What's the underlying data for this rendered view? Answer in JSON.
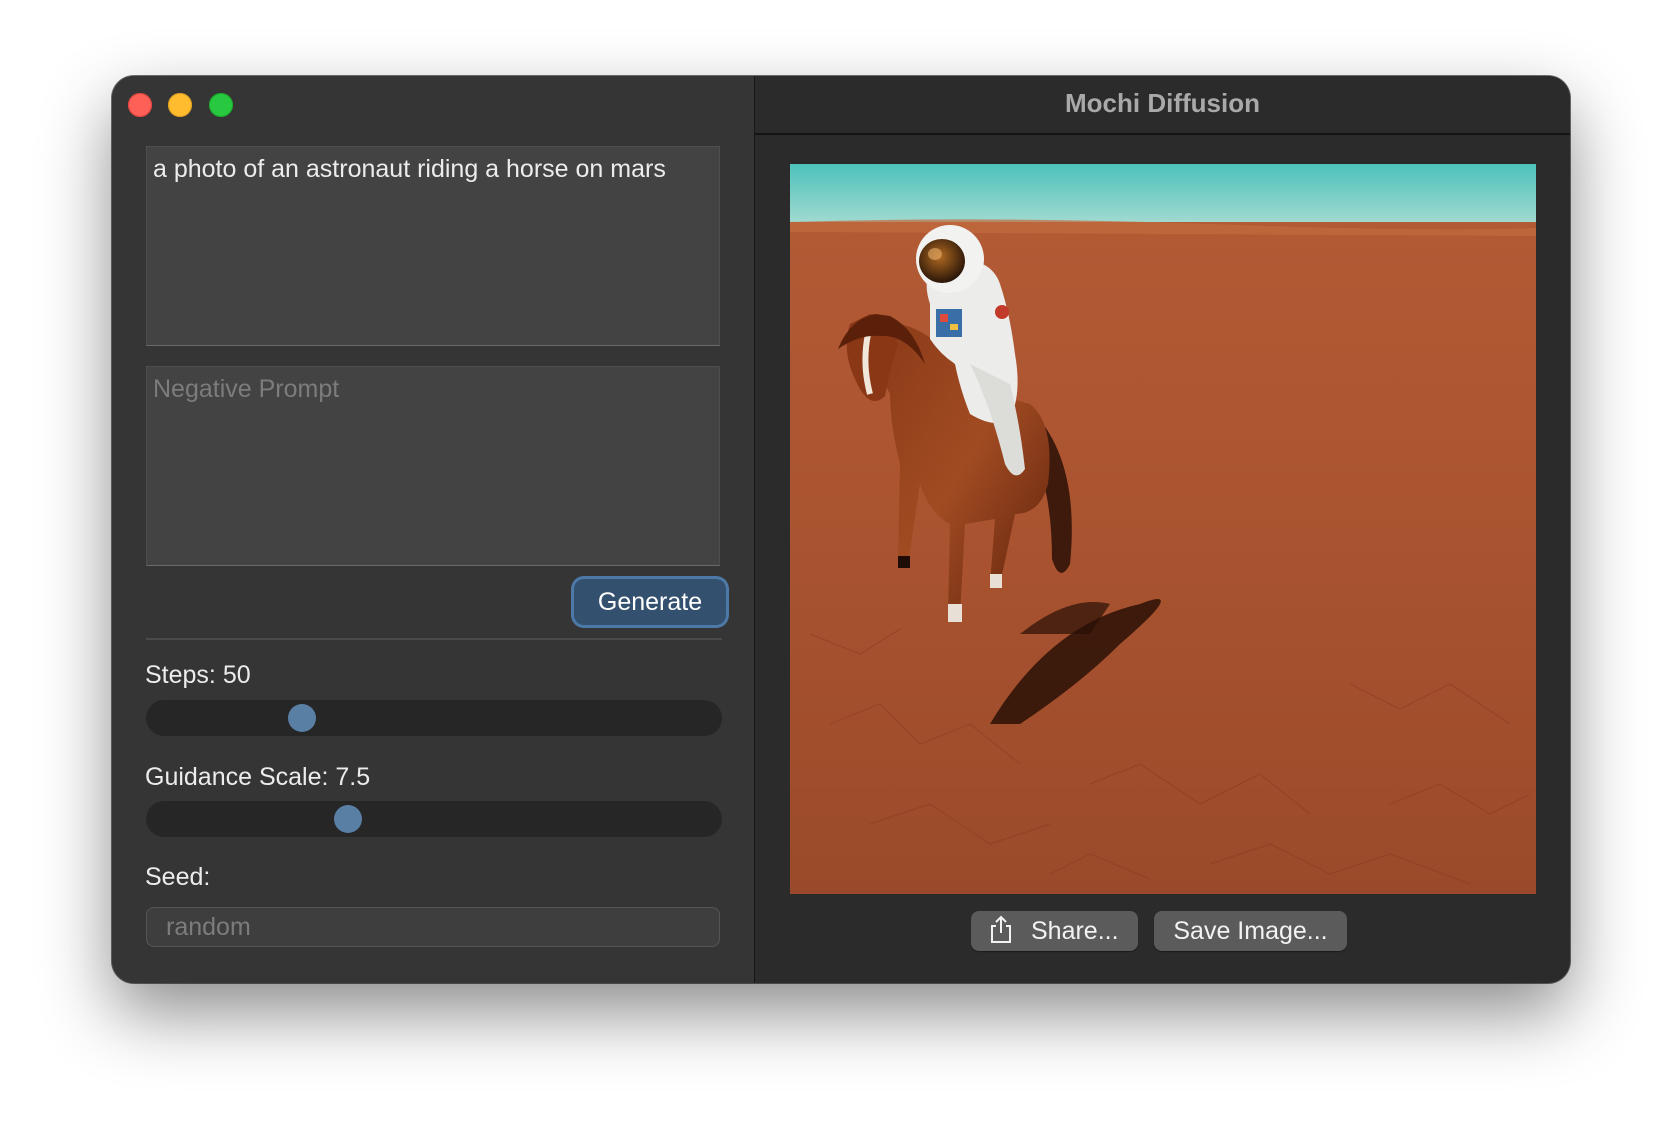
{
  "window": {
    "title": "Mochi Diffusion"
  },
  "sidebar": {
    "prompt_value": "a photo of an astronaut riding a horse on mars",
    "negative_prompt_placeholder": "Negative Prompt",
    "generate_label": "Generate",
    "steps_label": "Steps: 50",
    "steps_fraction": 0.27,
    "guidance_label": "Guidance Scale: 7.5",
    "guidance_fraction": 0.35,
    "seed_label": "Seed:",
    "seed_placeholder": "random"
  },
  "detail": {
    "share_label": "Share...",
    "save_label": "Save Image..."
  },
  "icons": {
    "share": "share-icon"
  },
  "colors": {
    "accent": "#34506f",
    "slider_thumb": "#5a7fa4"
  }
}
